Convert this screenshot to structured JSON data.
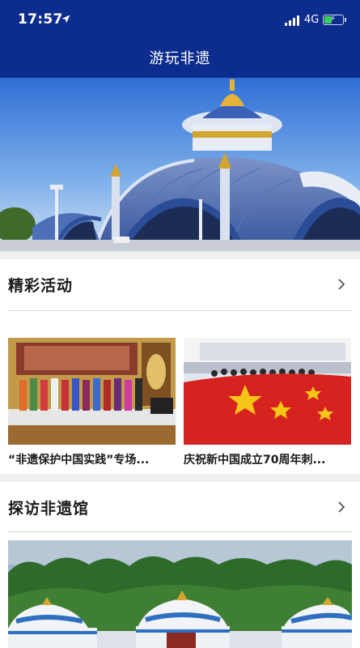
{
  "status_bar": {
    "time": "17:57",
    "network": "4G",
    "battery_level": 0.4,
    "battery_color": "#3ecf5a"
  },
  "header": {
    "title": "游玩非遗",
    "background": "#0c2c8e"
  },
  "hero": {
    "image": "theater-building-photo"
  },
  "sections": {
    "activities": {
      "title": "精彩活动",
      "chevron": "chevron-right-icon",
      "cards": [
        {
          "caption": "“非遗保护中国实践”专场...",
          "image": "stage-performance-photo"
        },
        {
          "caption": "庆祝新中国成立70周年刺...",
          "image": "flag-embroidery-photo"
        }
      ]
    },
    "venues": {
      "title": "探访非遗馆",
      "chevron": "chevron-right-icon",
      "image": "yurt-camp-photo"
    }
  }
}
